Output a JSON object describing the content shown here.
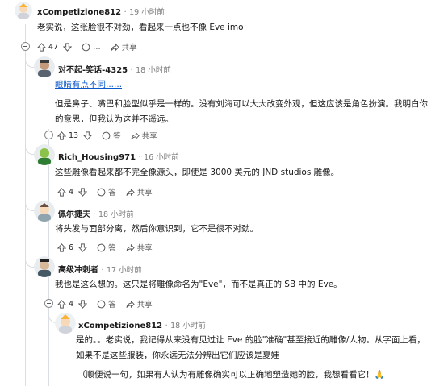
{
  "comments": [
    {
      "author": "xCompetizione812",
      "time": "19 小时前",
      "text": "老实说，这张脸很不对劲，看起来一点也不像 Eve imo",
      "votes": "47",
      "more": "…",
      "share": "共享"
    },
    {
      "author": "对不起-笑话-4325",
      "time": "18 小时前",
      "link": "眼睛有点不同......",
      "text": "但是鼻子、嘴巴和脸型似乎是一样的。没有刘海可以大大改变外观，但这应该是角色扮演。我明白你的意思，但我认为这并不遥远。",
      "votes": "13",
      "reply": "答",
      "share": "共享"
    },
    {
      "author": "Rich_Housing971",
      "time": "16 小时前",
      "text": "这些雕像看起来都不完全像源头，即使是 3000 美元的 JND studios 雕像。",
      "votes": "4",
      "reply": "答",
      "share": "共享"
    },
    {
      "author": "佩尔捷夫",
      "time": "18 小时前",
      "text": "将头发与面部分离，然后你意识到，它不是很不对劲。",
      "votes": "6",
      "reply": "答",
      "share": "共享"
    },
    {
      "author": "高级冲刺者",
      "time": "17 小时前",
      "text": "我也是这么想的。这只是将雕像命名为\"Eve\"，而不是真正的 SB 中的 Eve。",
      "votes": "4",
      "reply": "答",
      "share": "共享"
    },
    {
      "author": "xCompetizione812",
      "time": "18 小时前",
      "text": "是的。。老实说，我记得从来没有见过让 Eve 的脸\"准确\"甚至接近的雕像/人物。从字面上看，如果不是这些服装，你永远无法分辨出它们应该是夏娃",
      "text2": "（顺便说一句，如果有人认为有雕像确实可以正确地塑造她的脸，我想看看它！🙏"
    }
  ],
  "separator": "·",
  "colors": {
    "link": "#0a58ca",
    "meta": "#7c7c7c",
    "line": "#dadde2"
  }
}
